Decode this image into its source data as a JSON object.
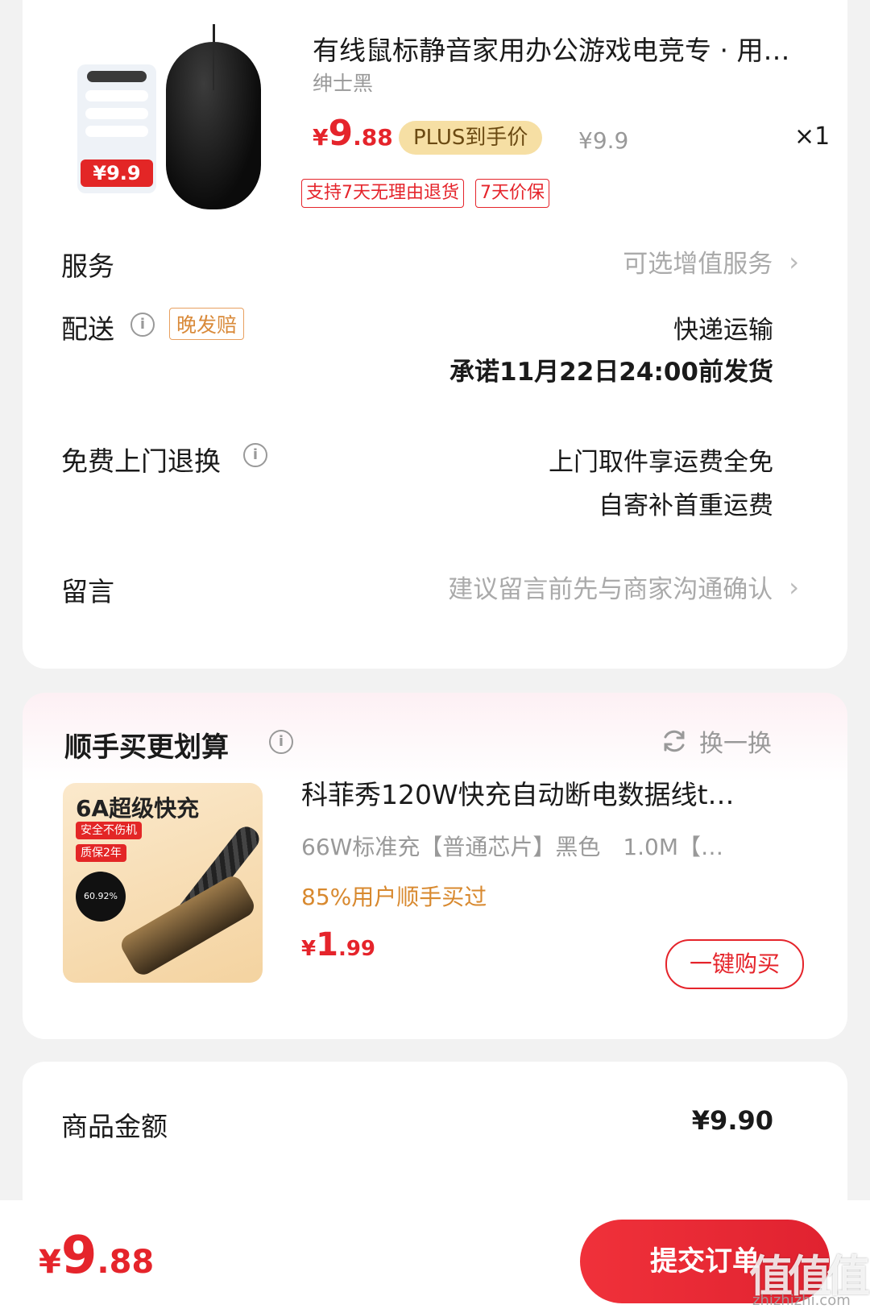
{
  "product": {
    "title": "有线鼠标静音家用办公游戏电竞专 · 用…",
    "spec": "绅士黑",
    "image_badge_price": "¥9.9",
    "price_yen": "¥",
    "price_int": "9",
    "price_dec": ".88",
    "plus_label": "PLUS到手价",
    "original_price": "¥9.9",
    "quantity": "×1",
    "tags": [
      "支持7天无理由退货",
      "7天价保"
    ]
  },
  "service": {
    "label": "服务",
    "value": "可选增值服务"
  },
  "delivery": {
    "label": "配送",
    "late_tag": "晚发赔",
    "method": "快递运输",
    "promise": "承诺11月22日24:00前发货"
  },
  "free_return": {
    "label": "免费上门退换",
    "line1": "上门取件享运费全免",
    "line2": "自寄补首重运费"
  },
  "message": {
    "label": "留言",
    "placeholder": "建议留言前先与商家沟通确认"
  },
  "addon": {
    "title": "顺手买更划算",
    "refresh_label": "换一换",
    "image_headline": "6A超级快充",
    "image_tag1": "安全不伤机",
    "image_tag2": "质保2年",
    "image_gauge": "60.92%",
    "name": "科菲秀120W快充自动断电数据线t…",
    "spec": "66W标准充【普通芯片】黑色　1.0M【…",
    "buy_rate": "85%用户顺手买过",
    "price_yen": "¥",
    "price_int": "1",
    "price_dec": ".99",
    "buy_button": "一键购买"
  },
  "summary": {
    "goods_amount_label": "商品金额",
    "goods_amount_value": "¥9.90"
  },
  "bottom_bar": {
    "total_yen": "¥",
    "total_int": "9",
    "total_dec": ".88",
    "submit_label": "提交订单"
  },
  "watermark": {
    "logo": "值值值",
    "url": "zhizhizhi.com"
  },
  "colors": {
    "accent_red": "#e5242b",
    "plus_gold": "#f6dfa4",
    "orange_text": "#d8892f"
  },
  "icons": [
    "info-icon",
    "chevron-right-icon",
    "refresh-icon"
  ]
}
